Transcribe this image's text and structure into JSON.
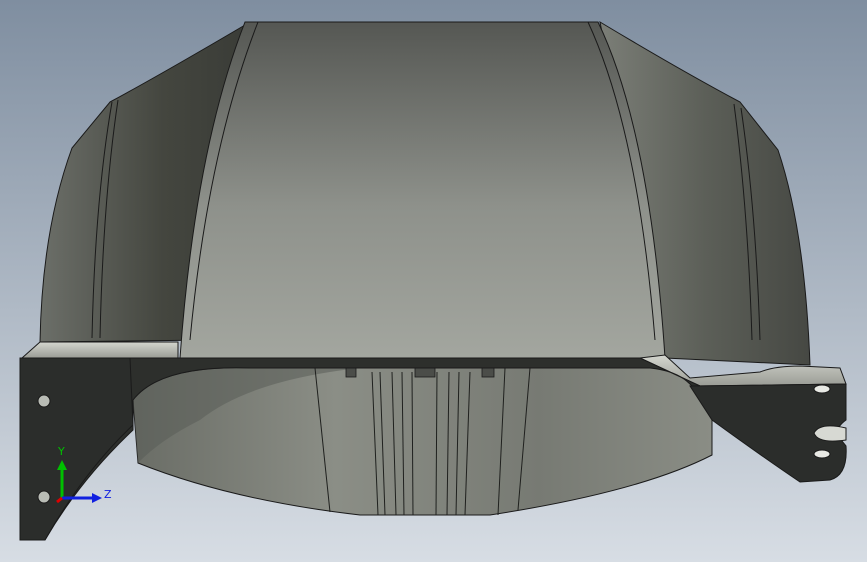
{
  "viewport": {
    "background_top": "#7f8ea0",
    "background_bottom": "#d7dde4"
  },
  "part": {
    "shell_color": "#8e918b",
    "shadow_color": "#3e403c",
    "bracket_color": "#2b2d2b",
    "highlight_color": "#c9ccc4",
    "edge_color": "#1a1a1a"
  },
  "triad": {
    "y_label": "Y",
    "z_label": "Z",
    "y_color": "#00c000",
    "z_color": "#1020e0",
    "x_color": "#e00000"
  }
}
